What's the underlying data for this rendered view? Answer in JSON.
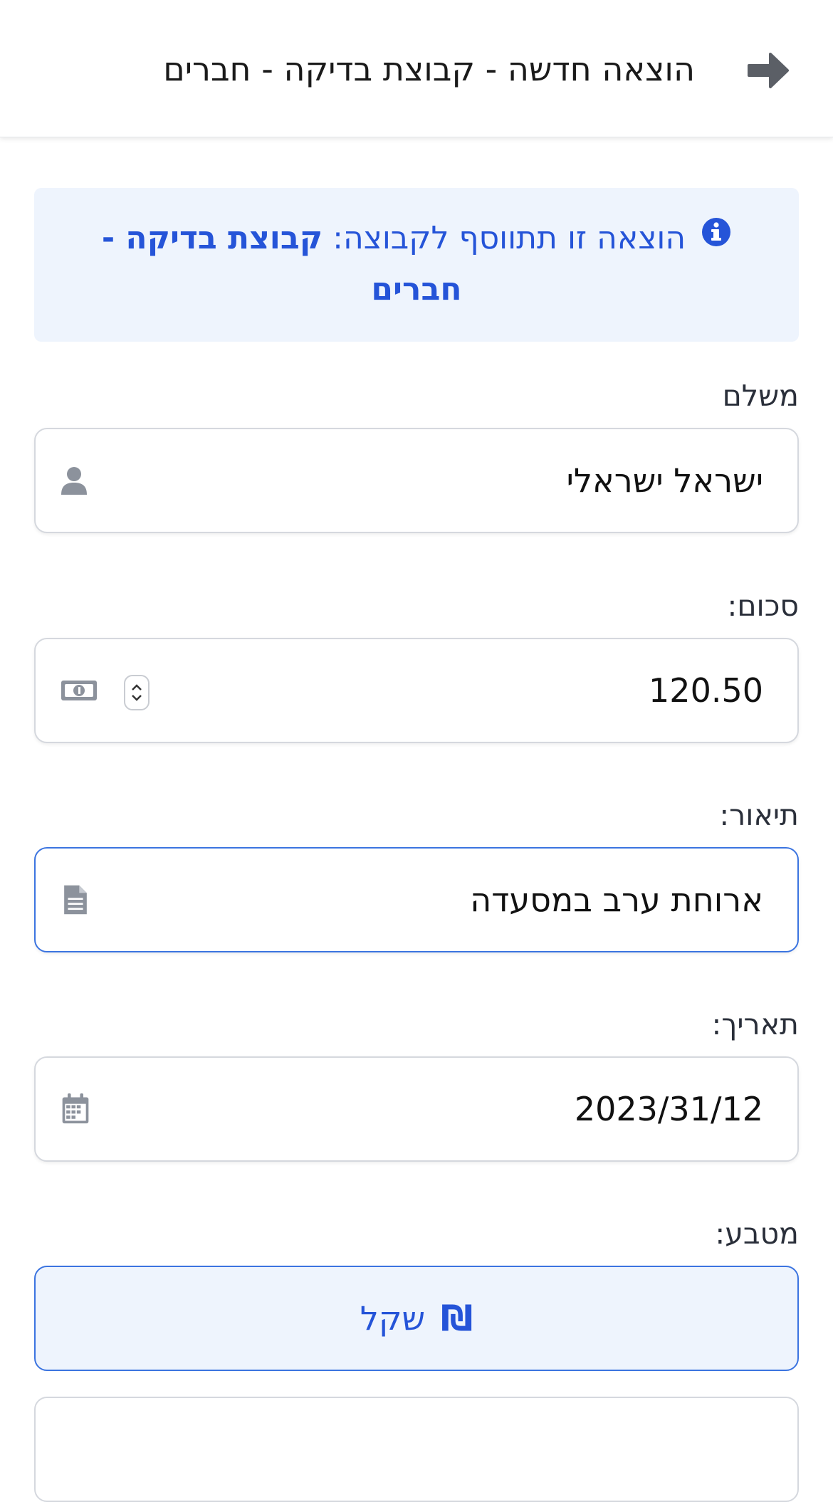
{
  "header": {
    "title": "הוצאה חדשה - קבוצת בדיקה - חברים",
    "back_icon": "arrow-right-icon"
  },
  "info": {
    "text_prefix": "הוצאה זו תתווסף לקבוצה:",
    "group_name": "קבוצת בדיקה - חברים",
    "icon": "info-circle-icon"
  },
  "payer": {
    "label": "משלם",
    "value": "ישראל ישראלי",
    "icon": "user-icon"
  },
  "amount": {
    "label": "סכום:",
    "value": "120.50",
    "icon": "money-bill-icon"
  },
  "description": {
    "label": "תיאור:",
    "value": "ארוחת ערב במסעדה",
    "icon": "file-text-icon"
  },
  "date": {
    "label": "תאריך:",
    "value": "2023/31/12",
    "icon": "calendar-icon"
  },
  "currency": {
    "label": "מטבע:",
    "selected_label": "שקל",
    "symbol": "₪"
  },
  "colors": {
    "accent": "#2554d8",
    "focus_border": "#3b74e0",
    "info_bg": "#eef4fd"
  }
}
